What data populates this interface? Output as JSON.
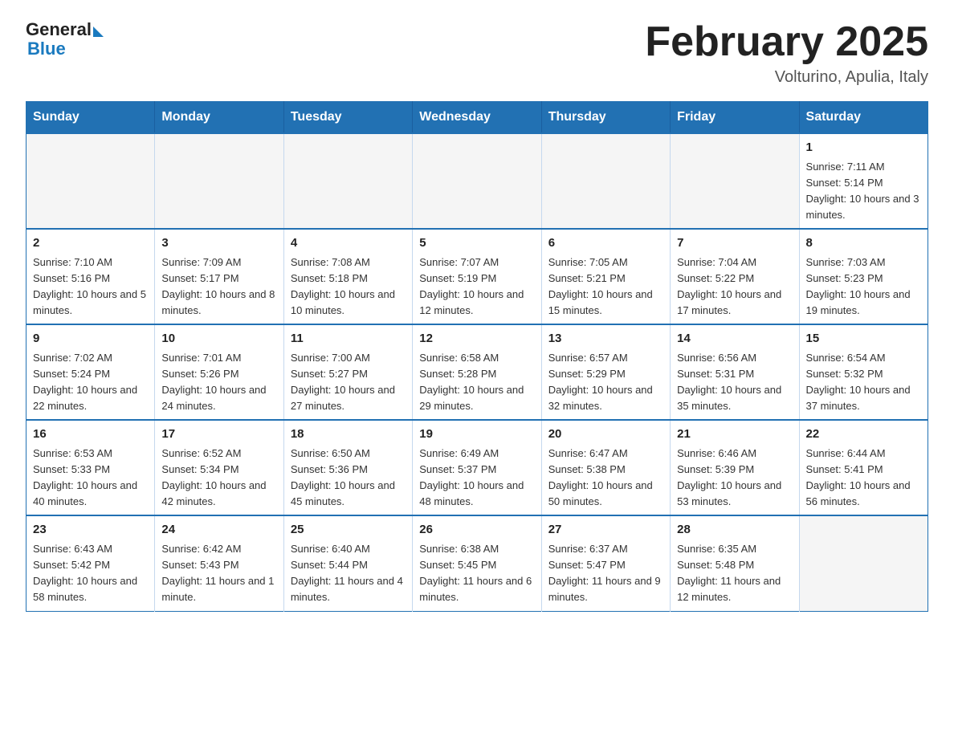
{
  "header": {
    "logo_general": "General",
    "logo_blue": "Blue",
    "month_title": "February 2025",
    "location": "Volturino, Apulia, Italy"
  },
  "weekdays": [
    "Sunday",
    "Monday",
    "Tuesday",
    "Wednesday",
    "Thursday",
    "Friday",
    "Saturday"
  ],
  "weeks": [
    [
      {
        "day": "",
        "info": ""
      },
      {
        "day": "",
        "info": ""
      },
      {
        "day": "",
        "info": ""
      },
      {
        "day": "",
        "info": ""
      },
      {
        "day": "",
        "info": ""
      },
      {
        "day": "",
        "info": ""
      },
      {
        "day": "1",
        "info": "Sunrise: 7:11 AM\nSunset: 5:14 PM\nDaylight: 10 hours and 3 minutes."
      }
    ],
    [
      {
        "day": "2",
        "info": "Sunrise: 7:10 AM\nSunset: 5:16 PM\nDaylight: 10 hours and 5 minutes."
      },
      {
        "day": "3",
        "info": "Sunrise: 7:09 AM\nSunset: 5:17 PM\nDaylight: 10 hours and 8 minutes."
      },
      {
        "day": "4",
        "info": "Sunrise: 7:08 AM\nSunset: 5:18 PM\nDaylight: 10 hours and 10 minutes."
      },
      {
        "day": "5",
        "info": "Sunrise: 7:07 AM\nSunset: 5:19 PM\nDaylight: 10 hours and 12 minutes."
      },
      {
        "day": "6",
        "info": "Sunrise: 7:05 AM\nSunset: 5:21 PM\nDaylight: 10 hours and 15 minutes."
      },
      {
        "day": "7",
        "info": "Sunrise: 7:04 AM\nSunset: 5:22 PM\nDaylight: 10 hours and 17 minutes."
      },
      {
        "day": "8",
        "info": "Sunrise: 7:03 AM\nSunset: 5:23 PM\nDaylight: 10 hours and 19 minutes."
      }
    ],
    [
      {
        "day": "9",
        "info": "Sunrise: 7:02 AM\nSunset: 5:24 PM\nDaylight: 10 hours and 22 minutes."
      },
      {
        "day": "10",
        "info": "Sunrise: 7:01 AM\nSunset: 5:26 PM\nDaylight: 10 hours and 24 minutes."
      },
      {
        "day": "11",
        "info": "Sunrise: 7:00 AM\nSunset: 5:27 PM\nDaylight: 10 hours and 27 minutes."
      },
      {
        "day": "12",
        "info": "Sunrise: 6:58 AM\nSunset: 5:28 PM\nDaylight: 10 hours and 29 minutes."
      },
      {
        "day": "13",
        "info": "Sunrise: 6:57 AM\nSunset: 5:29 PM\nDaylight: 10 hours and 32 minutes."
      },
      {
        "day": "14",
        "info": "Sunrise: 6:56 AM\nSunset: 5:31 PM\nDaylight: 10 hours and 35 minutes."
      },
      {
        "day": "15",
        "info": "Sunrise: 6:54 AM\nSunset: 5:32 PM\nDaylight: 10 hours and 37 minutes."
      }
    ],
    [
      {
        "day": "16",
        "info": "Sunrise: 6:53 AM\nSunset: 5:33 PM\nDaylight: 10 hours and 40 minutes."
      },
      {
        "day": "17",
        "info": "Sunrise: 6:52 AM\nSunset: 5:34 PM\nDaylight: 10 hours and 42 minutes."
      },
      {
        "day": "18",
        "info": "Sunrise: 6:50 AM\nSunset: 5:36 PM\nDaylight: 10 hours and 45 minutes."
      },
      {
        "day": "19",
        "info": "Sunrise: 6:49 AM\nSunset: 5:37 PM\nDaylight: 10 hours and 48 minutes."
      },
      {
        "day": "20",
        "info": "Sunrise: 6:47 AM\nSunset: 5:38 PM\nDaylight: 10 hours and 50 minutes."
      },
      {
        "day": "21",
        "info": "Sunrise: 6:46 AM\nSunset: 5:39 PM\nDaylight: 10 hours and 53 minutes."
      },
      {
        "day": "22",
        "info": "Sunrise: 6:44 AM\nSunset: 5:41 PM\nDaylight: 10 hours and 56 minutes."
      }
    ],
    [
      {
        "day": "23",
        "info": "Sunrise: 6:43 AM\nSunset: 5:42 PM\nDaylight: 10 hours and 58 minutes."
      },
      {
        "day": "24",
        "info": "Sunrise: 6:42 AM\nSunset: 5:43 PM\nDaylight: 11 hours and 1 minute."
      },
      {
        "day": "25",
        "info": "Sunrise: 6:40 AM\nSunset: 5:44 PM\nDaylight: 11 hours and 4 minutes."
      },
      {
        "day": "26",
        "info": "Sunrise: 6:38 AM\nSunset: 5:45 PM\nDaylight: 11 hours and 6 minutes."
      },
      {
        "day": "27",
        "info": "Sunrise: 6:37 AM\nSunset: 5:47 PM\nDaylight: 11 hours and 9 minutes."
      },
      {
        "day": "28",
        "info": "Sunrise: 6:35 AM\nSunset: 5:48 PM\nDaylight: 11 hours and 12 minutes."
      },
      {
        "day": "",
        "info": ""
      }
    ]
  ]
}
